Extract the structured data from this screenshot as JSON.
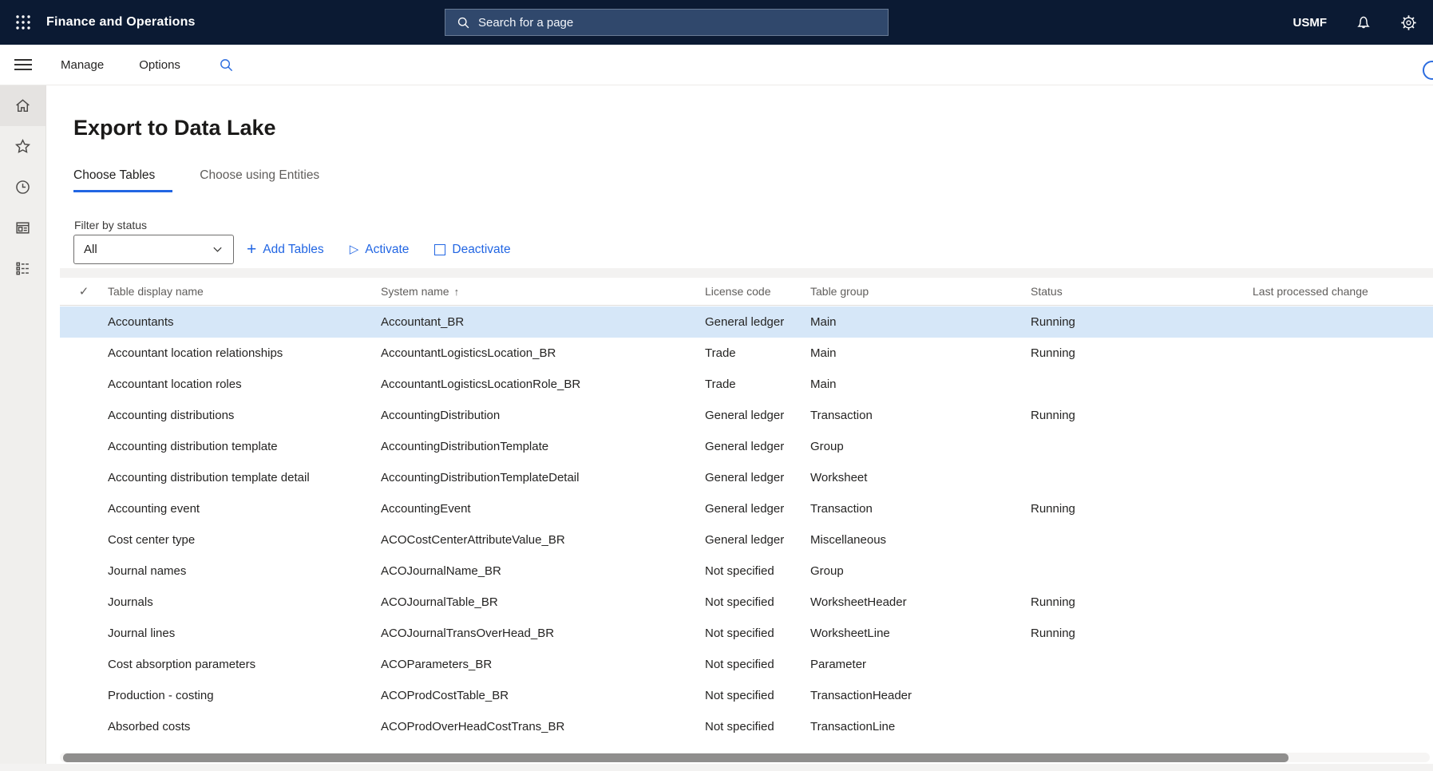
{
  "top_bar": {
    "app_title": "Finance and Operations",
    "search_placeholder": "Search for a page",
    "company": "USMF"
  },
  "action_pane": {
    "items": [
      {
        "label": "Manage"
      },
      {
        "label": "Options"
      }
    ]
  },
  "sidebar": {
    "items": [
      {
        "name": "home",
        "active": true
      },
      {
        "name": "favorites",
        "active": false
      },
      {
        "name": "recent",
        "active": false
      },
      {
        "name": "workspaces",
        "active": false
      },
      {
        "name": "modules",
        "active": false
      }
    ]
  },
  "page": {
    "title": "Export to Data Lake",
    "tabs": [
      {
        "label": "Choose Tables",
        "active": true
      },
      {
        "label": "Choose using Entities",
        "active": false
      }
    ],
    "filter": {
      "label": "Filter by status",
      "value": "All"
    },
    "actions": [
      {
        "label": "Add Tables",
        "icon": "plus-icon"
      },
      {
        "label": "Activate",
        "icon": "play-outline-icon"
      },
      {
        "label": "Deactivate",
        "icon": "square-outline-icon"
      }
    ]
  },
  "icons": {
    "checkmark": "✓",
    "sort_up": "↑",
    "plus": "+",
    "play": "▷"
  },
  "grid": {
    "columns": [
      "Table display name",
      "System name",
      "License code",
      "Table group",
      "Status",
      "Last processed change"
    ],
    "sort_column": "System name",
    "sort_direction": "ascending",
    "rows": [
      {
        "display_name": "Accountants",
        "system_name": "Accountant_BR",
        "license_code": "General ledger",
        "table_group": "Main",
        "status": "Running",
        "last_processed_change": "",
        "selected": true
      },
      {
        "display_name": "Accountant location relationships",
        "system_name": "AccountantLogisticsLocation_BR",
        "license_code": "Trade",
        "table_group": "Main",
        "status": "Running",
        "last_processed_change": "",
        "selected": false
      },
      {
        "display_name": "Accountant location roles",
        "system_name": "AccountantLogisticsLocationRole_BR",
        "license_code": "Trade",
        "table_group": "Main",
        "status": "",
        "last_processed_change": "",
        "selected": false
      },
      {
        "display_name": "Accounting distributions",
        "system_name": "AccountingDistribution",
        "license_code": "General ledger",
        "table_group": "Transaction",
        "status": "Running",
        "last_processed_change": "",
        "selected": false
      },
      {
        "display_name": "Accounting distribution template",
        "system_name": "AccountingDistributionTemplate",
        "license_code": "General ledger",
        "table_group": "Group",
        "status": "",
        "last_processed_change": "",
        "selected": false
      },
      {
        "display_name": "Accounting distribution template detail",
        "system_name": "AccountingDistributionTemplateDetail",
        "license_code": "General ledger",
        "table_group": "Worksheet",
        "status": "",
        "last_processed_change": "",
        "selected": false
      },
      {
        "display_name": "Accounting event",
        "system_name": "AccountingEvent",
        "license_code": "General ledger",
        "table_group": "Transaction",
        "status": "Running",
        "last_processed_change": "",
        "selected": false
      },
      {
        "display_name": "Cost center type",
        "system_name": "ACOCostCenterAttributeValue_BR",
        "license_code": "General ledger",
        "table_group": "Miscellaneous",
        "status": "",
        "last_processed_change": "",
        "selected": false
      },
      {
        "display_name": "Journal names",
        "system_name": "ACOJournalName_BR",
        "license_code": "Not specified",
        "table_group": "Group",
        "status": "",
        "last_processed_change": "",
        "selected": false
      },
      {
        "display_name": "Journals",
        "system_name": "ACOJournalTable_BR",
        "license_code": "Not specified",
        "table_group": "WorksheetHeader",
        "status": "Running",
        "last_processed_change": "",
        "selected": false
      },
      {
        "display_name": "Journal lines",
        "system_name": "ACOJournalTransOverHead_BR",
        "license_code": "Not specified",
        "table_group": "WorksheetLine",
        "status": "Running",
        "last_processed_change": "",
        "selected": false
      },
      {
        "display_name": "Cost absorption parameters",
        "system_name": "ACOParameters_BR",
        "license_code": "Not specified",
        "table_group": "Parameter",
        "status": "",
        "last_processed_change": "",
        "selected": false
      },
      {
        "display_name": "Production - costing",
        "system_name": "ACOProdCostTable_BR",
        "license_code": "Not specified",
        "table_group": "TransactionHeader",
        "status": "",
        "last_processed_change": "",
        "selected": false
      },
      {
        "display_name": "Absorbed costs",
        "system_name": "ACOProdOverHeadCostTrans_BR",
        "license_code": "Not specified",
        "table_group": "TransactionLine",
        "status": "",
        "last_processed_change": "",
        "selected": false
      }
    ]
  },
  "colors": {
    "topbar_background": "#0b1a33",
    "topbar_search_background": "#30486c",
    "accent_blue": "#2266e3",
    "selected_row_background": "#d6e7f8",
    "header_text": "#605e5c",
    "body_text": "#252423",
    "sidebar_background": "#f0efed"
  }
}
